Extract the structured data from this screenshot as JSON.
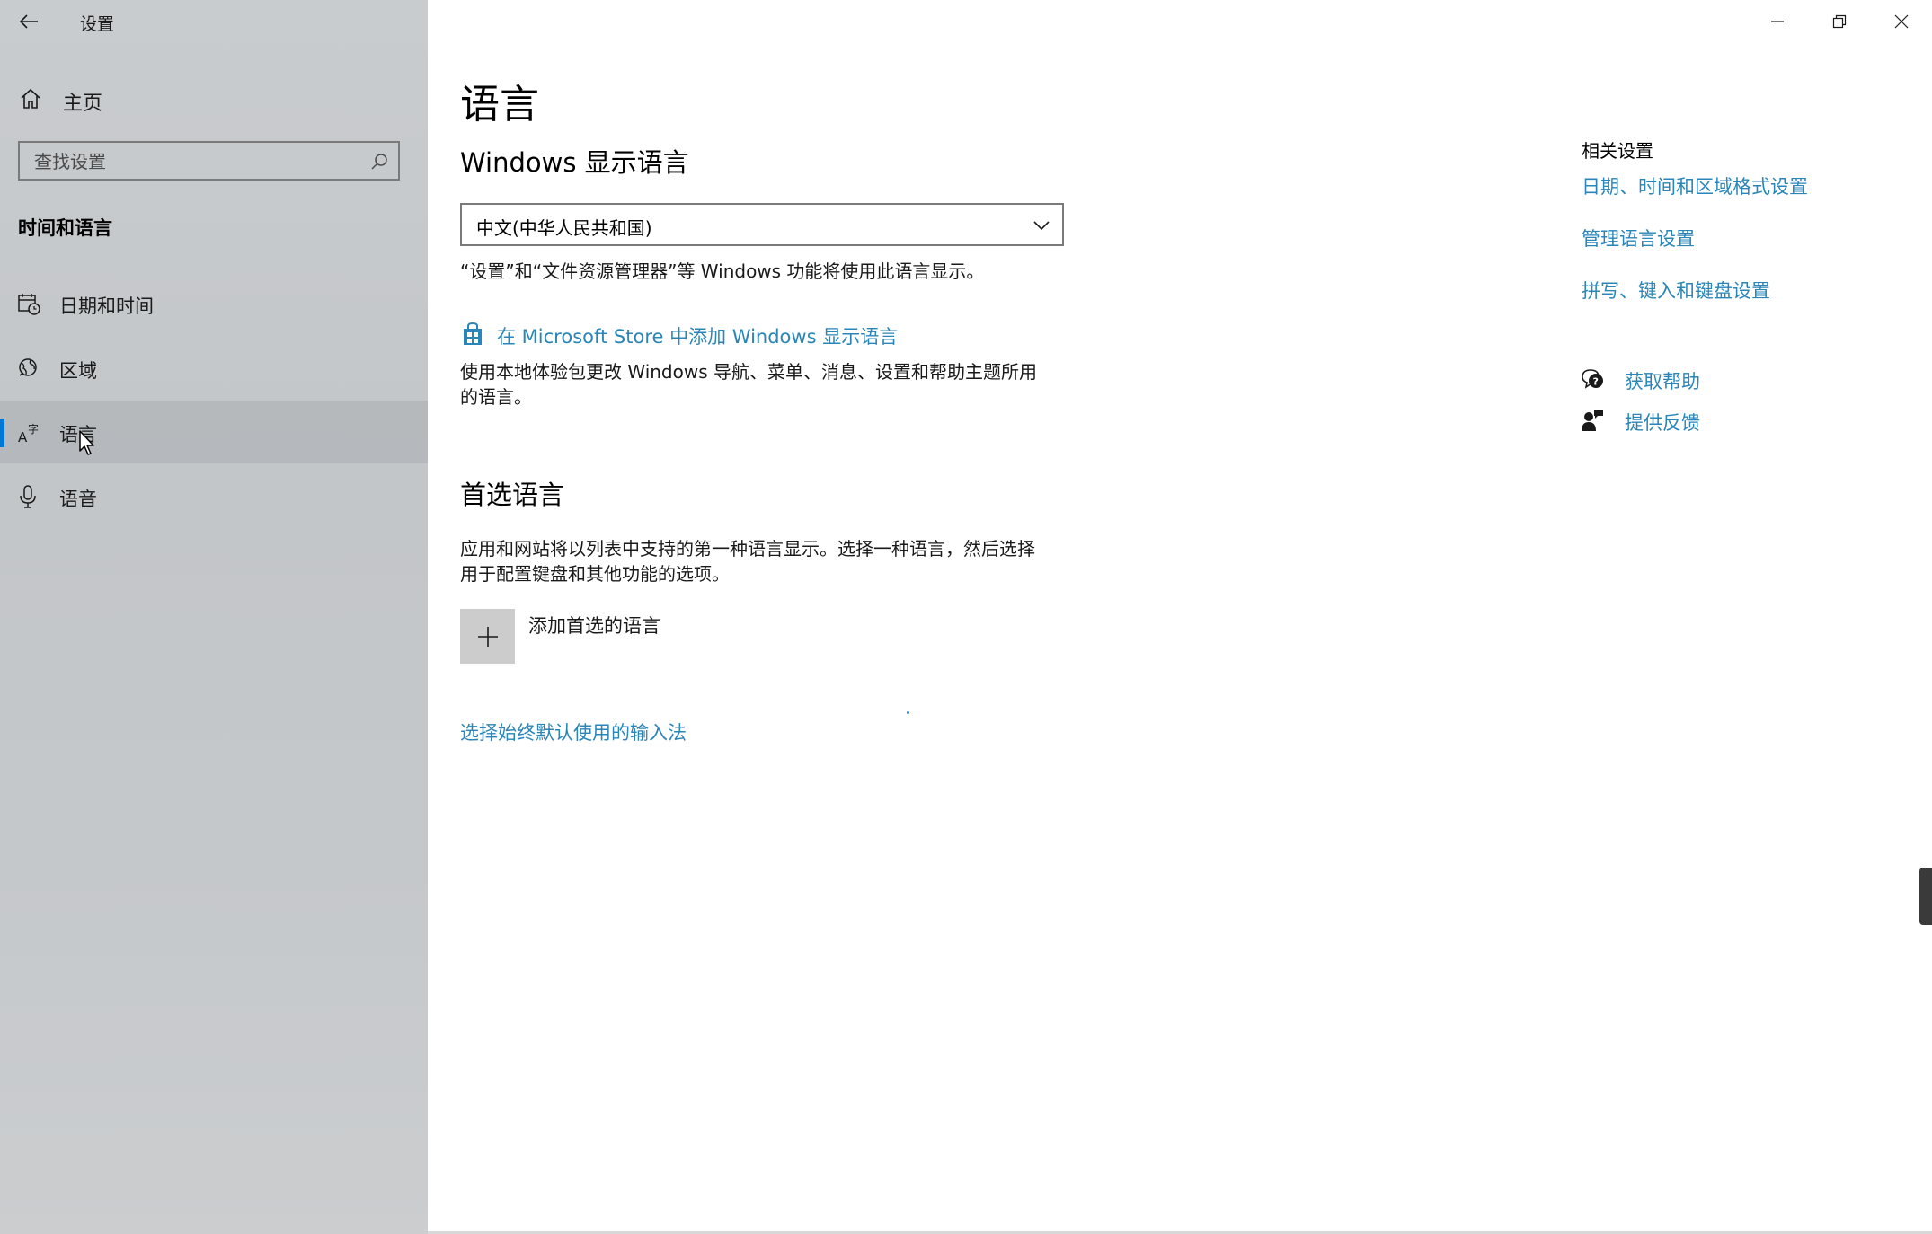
{
  "window": {
    "app_title": "设置",
    "controls": {
      "minimize_icon": "minimize-icon",
      "restore_icon": "restore-icon",
      "close_icon": "close-icon"
    }
  },
  "sidebar": {
    "home_label": "主页",
    "search_placeholder": "查找设置",
    "section_title": "时间和语言",
    "items": [
      {
        "label": "日期和时间",
        "icon": "calendar-clock-icon",
        "selected": false
      },
      {
        "label": "区域",
        "icon": "globe-icon",
        "selected": false
      },
      {
        "label": "语言",
        "icon": "language-icon",
        "selected": true
      },
      {
        "label": "语音",
        "icon": "microphone-icon",
        "selected": false
      }
    ]
  },
  "main": {
    "page_title": "语言",
    "display_language": {
      "heading": "Windows 显示语言",
      "selected_value": "中文(中华人民共和国)",
      "description": "“设置”和“文件资源管理器”等 Windows 功能将使用此语言显示。",
      "store_link": "在 Microsoft Store 中添加 Windows 显示语言",
      "store_description_line1": "使用本地体验包更改 Windows 导航、菜单、消息、设置和帮助主题所用",
      "store_description_line2": "的语言。"
    },
    "preferred_languages": {
      "heading": "首选语言",
      "description_line1": "应用和网站将以列表中支持的第一种语言显示。选择一种语言，然后选择",
      "description_line2": "用于配置键盘和其他功能的选项。",
      "add_label": "添加首选的语言",
      "input_method_link": "选择始终默认使用的输入法"
    }
  },
  "related": {
    "title": "相关设置",
    "links": [
      "日期、时间和区域格式设置",
      "管理语言设置",
      "拼写、键入和键盘设置"
    ],
    "help_label": "获取帮助",
    "feedback_label": "提供反馈"
  },
  "colors": {
    "accent": "#0078d4",
    "link": "#2a86b8",
    "sidebar_bg": "#c6c9cc",
    "selected_bg": "#b3b6b9"
  }
}
